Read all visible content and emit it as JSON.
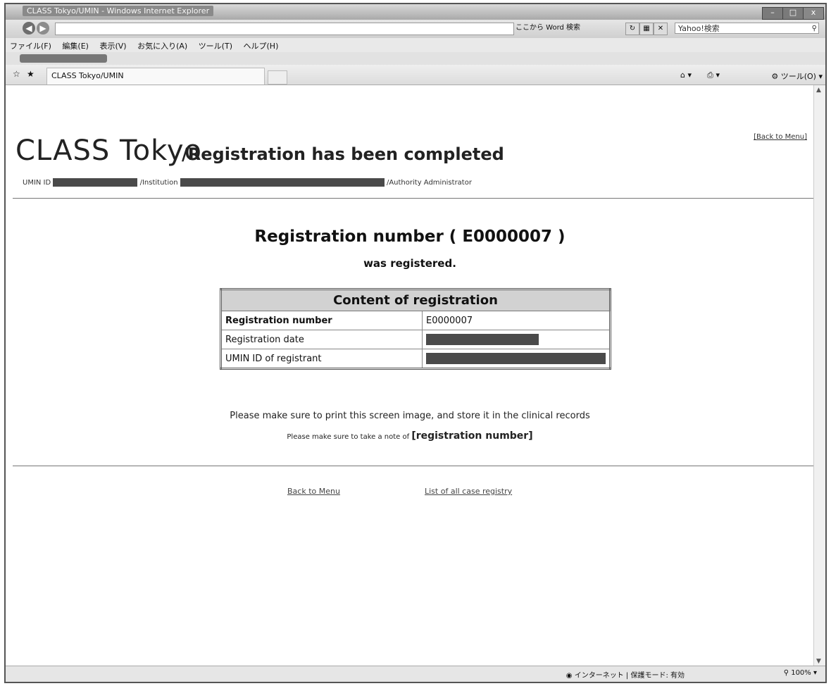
{
  "window": {
    "title": "CLASS Tokyo/UMIN - Windows Internet Explorer",
    "controls": {
      "minimize": "–",
      "maximize": "□",
      "close": "x"
    }
  },
  "addressbar": {
    "url": "",
    "search_provider": "Yahoo!検索",
    "hint": "ここから Word 検索"
  },
  "menubar": {
    "items": [
      "ファイル(F)",
      "編集(E)",
      "表示(V)",
      "お気に入り(A)",
      "ツール(T)",
      "ヘルプ(H)"
    ]
  },
  "addon": {
    "label": ""
  },
  "tabbar": {
    "tab_title": "CLASS Tokyo/UMIN",
    "tools_label": "ツール(O)"
  },
  "page": {
    "back_to_menu_top": "[Back to Menu]",
    "brand": "CLASS Tokyo",
    "heading": "/Registration has been completed",
    "user": {
      "umin_id_label": "UMIN ID",
      "institution_label": "/Institution",
      "authority": "/Authority Administrator"
    },
    "registration_title": "Registration number ( E0000007 )",
    "registration_sub": "was registered.",
    "table": {
      "header": "Content of registration",
      "rows": [
        {
          "key": "Registration number",
          "value": "E0000007"
        },
        {
          "key": "Registration date",
          "value": ""
        },
        {
          "key": "UMIN ID of registrant",
          "value": ""
        }
      ]
    },
    "note_print": "Please make sure to print this screen image, and store it in the clinical records",
    "note_number_prefix": "Please make sure to take a note of",
    "note_number_bold": "[registration number]",
    "link_menu": "Back to Menu",
    "link_list": "List of all case registry"
  },
  "statusbar": {
    "zone": "インターネット | 保護モード: 有効",
    "zoom": "100%"
  }
}
